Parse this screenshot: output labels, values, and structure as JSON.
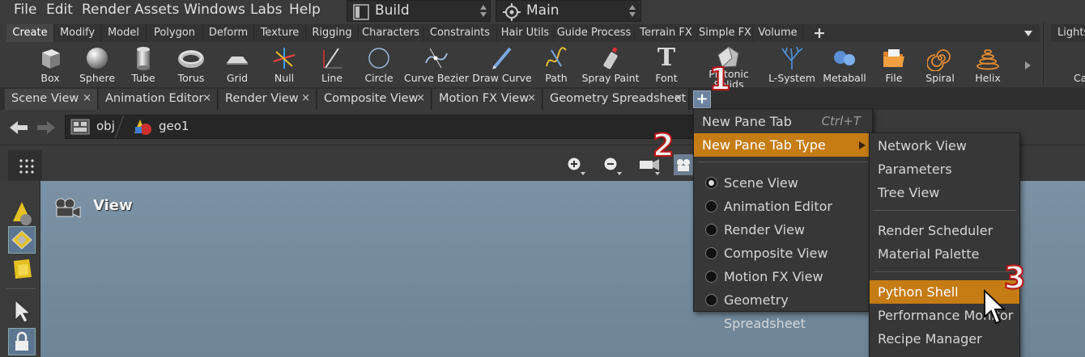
{
  "menubar": {
    "items": [
      "File",
      "Edit",
      "Render",
      "Assets",
      "Windows",
      "Labs",
      "Help"
    ],
    "desktop": "Build",
    "context": "Main"
  },
  "shelf": {
    "tabs": [
      "Create",
      "Modify",
      "Model",
      "Polygon",
      "Deform",
      "Texture",
      "Rigging",
      "Characters",
      "Constraints",
      "Hair Utils",
      "Guide Process",
      "Terrain FX",
      "Simple FX",
      "Volume"
    ],
    "add_tab": "+",
    "right_tab": "Lights",
    "right_tool_fragment": "Ca",
    "tools": [
      "Box",
      "Sphere",
      "Tube",
      "Torus",
      "Grid",
      "Null",
      "Line",
      "Circle",
      "Curve Bezier",
      "Draw Curve",
      "Path",
      "Spray Paint",
      "Font",
      "Platonic Solids",
      "L-System",
      "Metaball",
      "File",
      "Spiral",
      "Helix"
    ],
    "font_icon_glyph": "T"
  },
  "pane_tabs": {
    "tabs": [
      {
        "label": "Scene View",
        "close": "×"
      },
      {
        "label": "Animation Editor",
        "close": "×"
      },
      {
        "label": "Render View",
        "close": "×"
      },
      {
        "label": "Composite View",
        "close": "×"
      },
      {
        "label": "Motion FX View",
        "close": "×"
      },
      {
        "label": "Geometry Spreadsheet",
        "close": "×"
      }
    ],
    "add": "+"
  },
  "path": {
    "level1": "obj",
    "level2": "geo1"
  },
  "viewport": {
    "label": "View"
  },
  "menu1": {
    "new_pane_tab": "New Pane Tab",
    "shortcut": "Ctrl+T",
    "new_pane_tab_type": "New Pane Tab Type",
    "tabs": [
      "Scene View",
      "Animation Editor",
      "Render View",
      "Composite View",
      "Motion FX View",
      "Geometry Spreadsheet"
    ],
    "selected_index": 0
  },
  "menu2": {
    "group1": [
      "Network View",
      "Parameters",
      "Tree View"
    ],
    "group2": [
      "Render Scheduler",
      "Material Palette"
    ],
    "group3": [
      "Python Shell",
      "Performance Monitor",
      "Recipe Manager"
    ]
  },
  "callouts": [
    "1",
    "2",
    "3"
  ],
  "colors": {
    "highlight": "#c57c14",
    "viewport": "#7b92a6",
    "callout_stroke": "#b81818"
  }
}
